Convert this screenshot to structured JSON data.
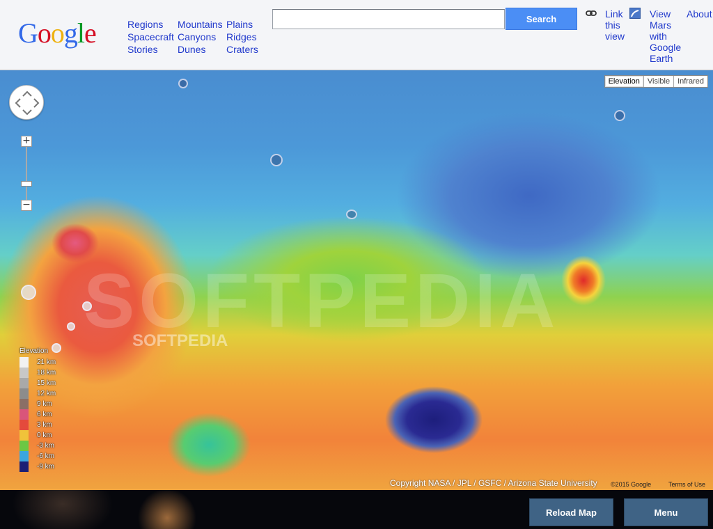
{
  "header": {
    "logo_letters": [
      {
        "char": "G",
        "color": "#3369e8"
      },
      {
        "char": "o",
        "color": "#d50f25"
      },
      {
        "char": "o",
        "color": "#eeb211"
      },
      {
        "char": "g",
        "color": "#3369e8"
      },
      {
        "char": "l",
        "color": "#009925"
      },
      {
        "char": "e",
        "color": "#d50f25"
      }
    ],
    "nav_columns": [
      [
        "Regions",
        "Spacecraft",
        "Stories"
      ],
      [
        "Mountains",
        "Canyons",
        "Dunes"
      ],
      [
        "Plains",
        "Ridges",
        "Craters"
      ]
    ],
    "search": {
      "value": "",
      "placeholder": "",
      "button_label": "Search"
    },
    "link_this_view": "Link this view",
    "view_google_earth": "View Mars with Google Earth",
    "about": "About"
  },
  "map": {
    "map_types": [
      "Elevation",
      "Visible",
      "Infrared"
    ],
    "selected_map_type": "Elevation",
    "zoom_in": "+",
    "zoom_out": "−",
    "legend": {
      "title": "Elevation",
      "entries": [
        {
          "label": "21 km",
          "color": "#f2f2f2"
        },
        {
          "label": "18 km",
          "color": "#c8c8c8"
        },
        {
          "label": "15 km",
          "color": "#a9a9a9"
        },
        {
          "label": "12 km",
          "color": "#8c8c8c"
        },
        {
          "label": "9 km",
          "color": "#8a6f66"
        },
        {
          "label": "6 km",
          "color": "#d9557a"
        },
        {
          "label": "3 km",
          "color": "#e44a3c"
        },
        {
          "label": "0 km",
          "color": "#f0c33a"
        },
        {
          "label": "-3 km",
          "color": "#6cc744"
        },
        {
          "label": "-6 km",
          "color": "#3aa6e0"
        },
        {
          "label": "-9 km",
          "color": "#1b1f75"
        }
      ]
    },
    "watermark": "SOFTPEDIA",
    "watermark_small": "SOFTPEDIA",
    "copyright": "Copyright NASA / JPL / GSFC / Arizona State University",
    "google_copyright": "©2015 Google",
    "terms": "Terms of Use"
  },
  "footer": {
    "reload_label": "Reload Map",
    "menu_label": "Menu"
  },
  "colors": {
    "link": "#2039cc",
    "search_button": "#4b8ef5",
    "footer_button": "#3f6385"
  }
}
